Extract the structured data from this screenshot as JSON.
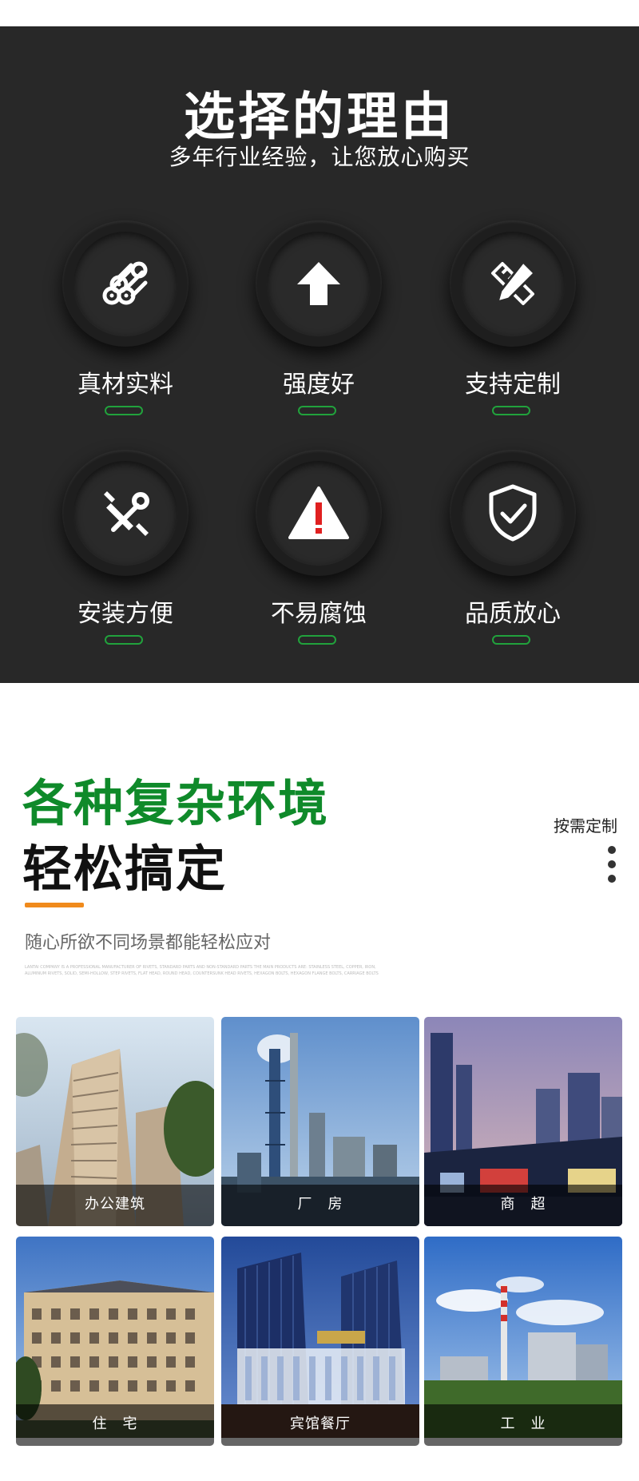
{
  "reasons": {
    "title": "选择的理由",
    "subtitle": "多年行业经验，让您放心购买",
    "features": [
      {
        "label": "真材实料",
        "icon": "material-rolls-icon"
      },
      {
        "label": "强度好",
        "icon": "arrow-up-icon"
      },
      {
        "label": "支持定制",
        "icon": "pencil-ruler-icon"
      },
      {
        "label": "安装方便",
        "icon": "wrench-screwdriver-icon"
      },
      {
        "label": "不易腐蚀",
        "icon": "warning-triangle-icon"
      },
      {
        "label": "品质放心",
        "icon": "shield-check-icon"
      }
    ]
  },
  "environments": {
    "title_green": "各种复杂环境",
    "title_black": "轻松搞定",
    "side_tag": "按需定制",
    "description": "随心所欲不同场景都能轻松应对",
    "fine_print": "LANTAI COMPANY IS A PROFESSIONAL MANUFACTURER OF RIVETS, STANDARD PARTS AND NON-STANDARD PARTS THE MAIN PRODUCTS ARE: STAINLESS STEEL, COPPER, IRON, ALUMINUM RIVETS, SOLID, SEMI-HOLLOW, STEP RIVETS, FLAT HEAD, ROUND HEAD, COUNTERSUNK HEAD RIVETS, HEXAGON BOLTS, HEXAGON FLANGE BOLTS, CARRIAGE BOLTS",
    "scenes": [
      {
        "caption": "办公建筑"
      },
      {
        "caption": "厂　房"
      },
      {
        "caption": "商　超"
      },
      {
        "caption": "住　宅"
      },
      {
        "caption": "宾馆餐厅"
      },
      {
        "caption": "工　业"
      }
    ]
  },
  "colors": {
    "dark_bg": "#282828",
    "accent_green": "#0f8a2a",
    "dash_green": "#21a23c",
    "orange": "#f08a1c"
  }
}
